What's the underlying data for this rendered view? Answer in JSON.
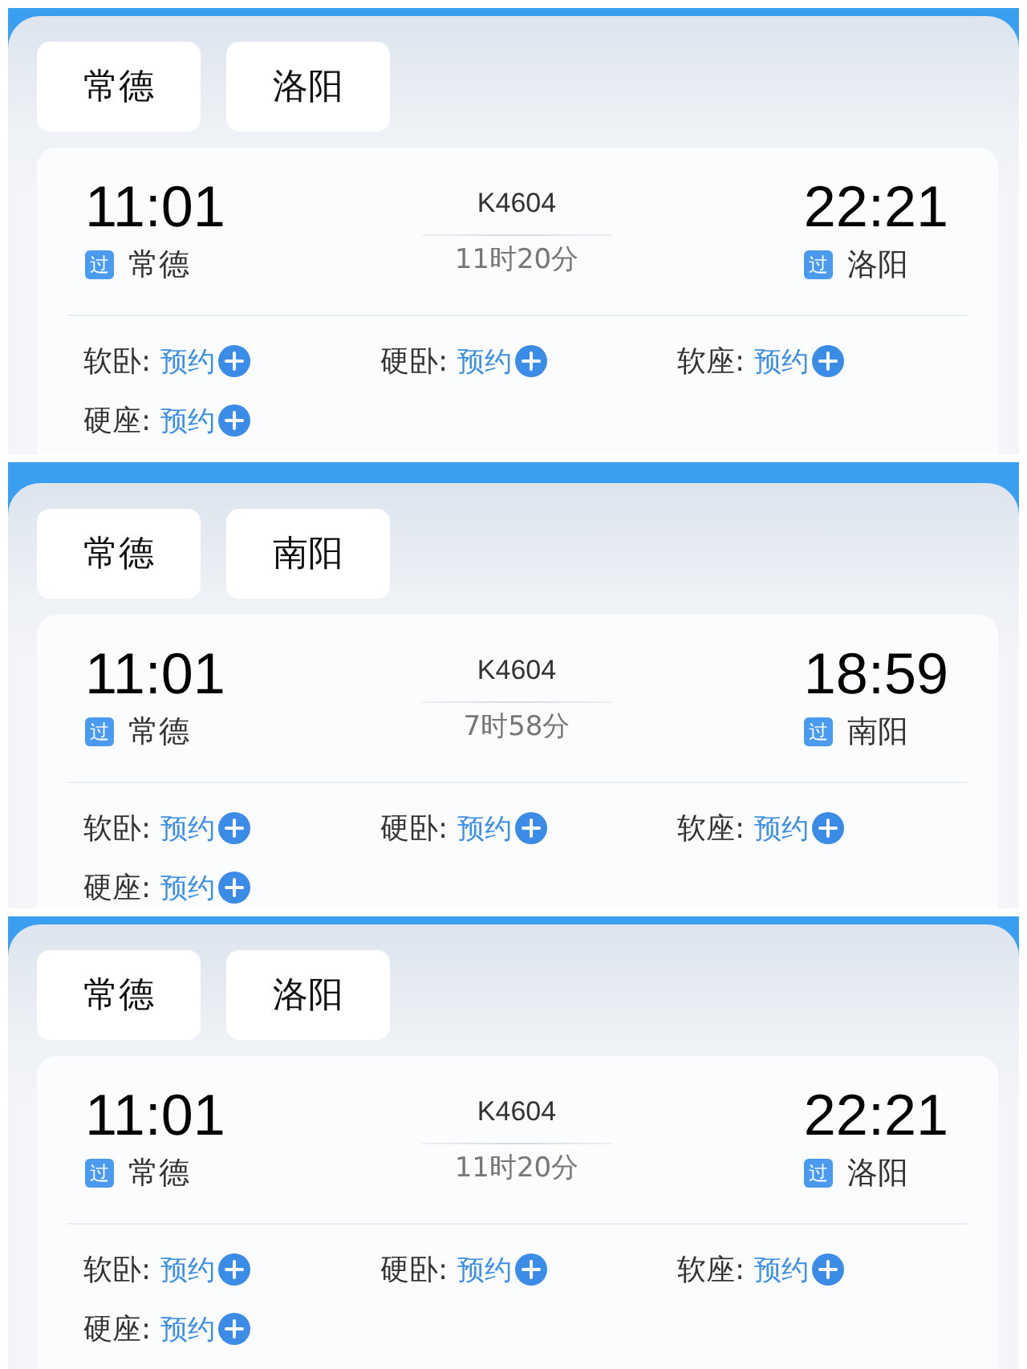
{
  "panels": [
    {
      "tabs": [
        {
          "label": "常德"
        },
        {
          "label": "洛阳"
        }
      ],
      "train": {
        "number": "K4604",
        "duration": "11时20分",
        "departure": {
          "time": "11:01",
          "badge": "过",
          "station": "常德"
        },
        "arrival": {
          "time": "22:21",
          "badge": "过",
          "station": "洛阳"
        }
      },
      "seats": [
        {
          "label": "软卧:",
          "action": "预约"
        },
        {
          "label": "硬卧:",
          "action": "预约"
        },
        {
          "label": "软座:",
          "action": "预约"
        },
        {
          "label": "硬座:",
          "action": "预约"
        }
      ]
    },
    {
      "tabs": [
        {
          "label": "常德"
        },
        {
          "label": "南阳"
        }
      ],
      "train": {
        "number": "K4604",
        "duration": "7时58分",
        "departure": {
          "time": "11:01",
          "badge": "过",
          "station": "常德"
        },
        "arrival": {
          "time": "18:59",
          "badge": "过",
          "station": "南阳"
        }
      },
      "seats": [
        {
          "label": "软卧:",
          "action": "预约"
        },
        {
          "label": "硬卧:",
          "action": "预约"
        },
        {
          "label": "软座:",
          "action": "预约"
        },
        {
          "label": "硬座:",
          "action": "预约"
        }
      ]
    },
    {
      "tabs": [
        {
          "label": "常德"
        },
        {
          "label": "洛阳"
        }
      ],
      "train": {
        "number": "K4604",
        "duration": "11时20分",
        "departure": {
          "time": "11:01",
          "badge": "过",
          "station": "常德"
        },
        "arrival": {
          "time": "22:21",
          "badge": "过",
          "station": "洛阳"
        }
      },
      "seats": [
        {
          "label": "软卧:",
          "action": "预约"
        },
        {
          "label": "硬卧:",
          "action": "预约"
        },
        {
          "label": "软座:",
          "action": "预约"
        },
        {
          "label": "硬座:",
          "action": "预约"
        }
      ]
    }
  ]
}
